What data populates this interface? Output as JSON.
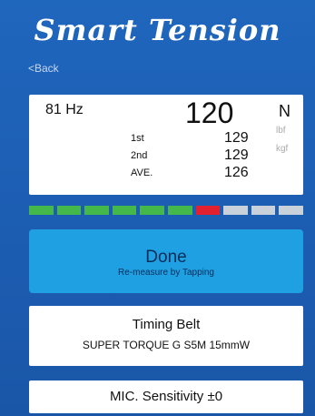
{
  "app": {
    "title": "Smart Tension"
  },
  "nav": {
    "back_label": "<Back"
  },
  "reading": {
    "frequency": "81 Hz",
    "tension_value": "120",
    "units": [
      "N",
      "lbf",
      "kgf"
    ],
    "rows": [
      {
        "label": "1st",
        "value": "129"
      },
      {
        "label": "2nd",
        "value": "129"
      },
      {
        "label": "AVE.",
        "value": "126"
      }
    ]
  },
  "meter": {
    "segments": 10,
    "active_index": 6,
    "colors": {
      "ok": "#44b84a",
      "active": "#e2202f",
      "inactive": "#c9d1db"
    }
  },
  "done_button": {
    "label": "Done",
    "sub_label": "Re-measure by Tapping"
  },
  "belt": {
    "title": "Timing Belt",
    "spec": "SUPER TORQUE G  S5M  15mmW"
  },
  "mic": {
    "label": "MIC. Sensitivity  ±0"
  }
}
